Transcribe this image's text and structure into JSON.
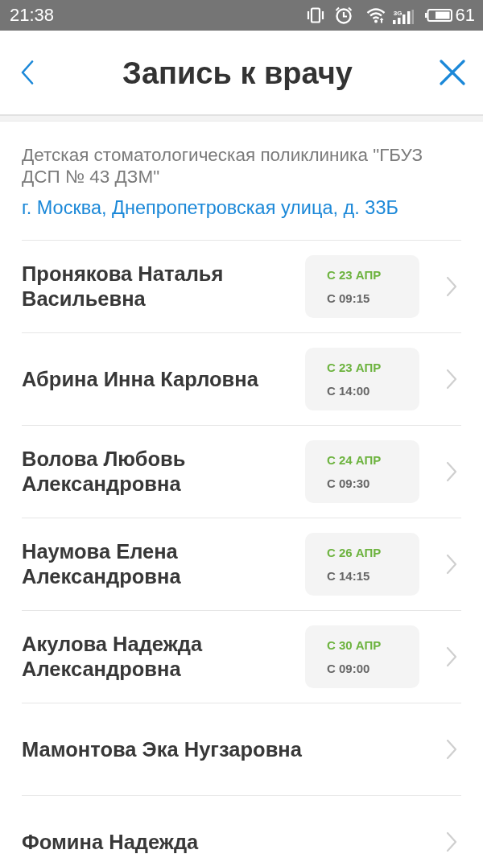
{
  "status_bar": {
    "time": "21:38",
    "network": "3G",
    "battery": "61"
  },
  "header": {
    "title": "Запись к врачу"
  },
  "clinic": {
    "name": "Детская стоматологическая поликлиника \"ГБУЗ ДСП № 43 ДЗМ\"",
    "address": "г. Москва, Днепропетровская улица, д. 33Б"
  },
  "doctors": [
    {
      "name": "Пронякова Наталья Васильевна",
      "slot": {
        "date": "С 23 АПР",
        "time": "С 09:15"
      }
    },
    {
      "name": "Абрина Инна Карловна",
      "slot": {
        "date": "С 23 АПР",
        "time": "С 14:00"
      }
    },
    {
      "name": "Волова Любовь Александровна",
      "slot": {
        "date": "С 24 АПР",
        "time": "С 09:30"
      }
    },
    {
      "name": "Наумова Елена Александровна",
      "slot": {
        "date": "С 26 АПР",
        "time": "С 14:15"
      }
    },
    {
      "name": "Акулова Надежда Александровна",
      "slot": {
        "date": "С 30 АПР",
        "time": "С 09:00"
      }
    },
    {
      "name": "Мамонтова Эка Нугзаровна"
    },
    {
      "name": "Фомина Надежда"
    }
  ]
}
